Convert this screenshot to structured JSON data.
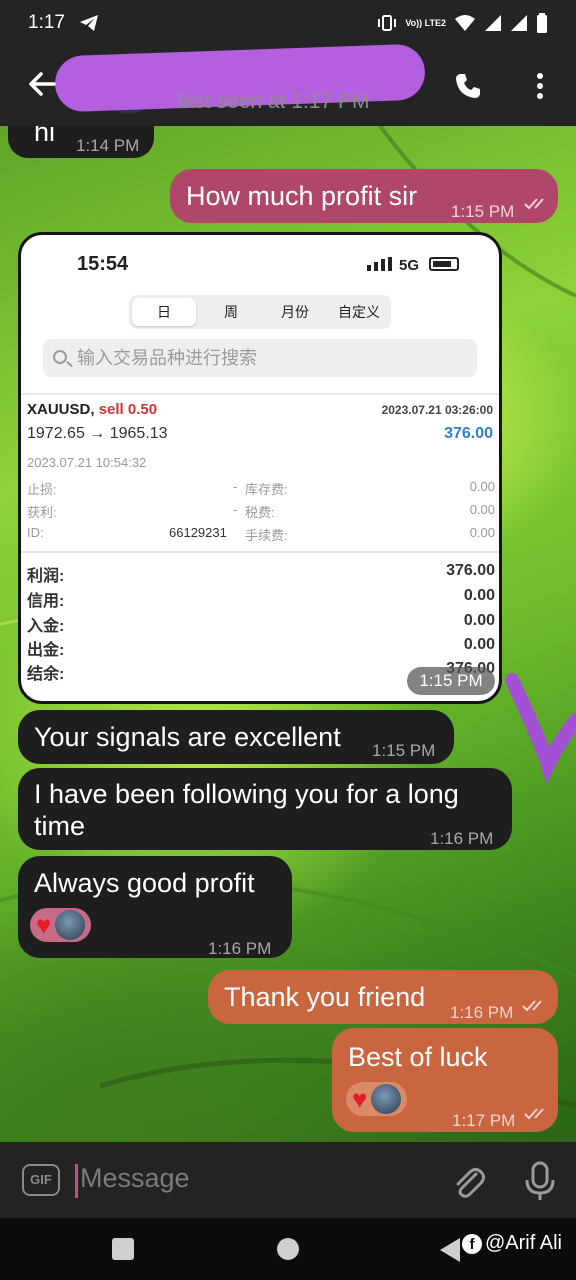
{
  "status_bar": {
    "time": "1:17",
    "network_label": "Vo)) LTE2"
  },
  "header": {
    "last_seen": "last seen at 1:17 PM"
  },
  "messages": [
    {
      "direction": "in",
      "text": "hi",
      "time": "1:14 PM"
    },
    {
      "direction": "out",
      "text": "How much profit sir",
      "time": "1:15 PM"
    },
    {
      "direction": "out",
      "type": "image",
      "time": "1:15 PM"
    },
    {
      "direction": "in",
      "text": "Your signals are excellent",
      "time": "1:15 PM"
    },
    {
      "direction": "in",
      "text_lines": [
        "I have been following you for a long",
        "time"
      ],
      "time": "1:16 PM"
    },
    {
      "direction": "in",
      "text": "Always good profit",
      "time": "1:16 PM",
      "reaction": "heart"
    },
    {
      "direction": "out",
      "text": "Thank you friend",
      "time": "1:16 PM"
    },
    {
      "direction": "out",
      "text": "Best of luck",
      "time": "1:17 PM",
      "reaction": "heart"
    }
  ],
  "trade_screenshot": {
    "status_time": "15:54",
    "network": "5G",
    "tabs": [
      "日",
      "周",
      "月份",
      "自定义"
    ],
    "search_placeholder": "输入交易品种进行搜索",
    "symbol": "XAUUSD,",
    "side": "sell 0.50",
    "close_time": "2023.07.21 03:26:00",
    "prices": "1972.65 → 1965.13",
    "profit": "376.00",
    "open_time": "2023.07.21 10:54:32",
    "details": [
      {
        "label": "止损:",
        "value": "-",
        "label2": "库存费:",
        "value2": "0.00"
      },
      {
        "label": "获利:",
        "value": "-",
        "label2": "税费:",
        "value2": "0.00"
      },
      {
        "label": "ID:",
        "value": "66129231",
        "label2": "手续费:",
        "value2": "0.00"
      }
    ],
    "summary": [
      {
        "label": "利润:",
        "value": "376.00"
      },
      {
        "label": "信用:",
        "value": "0.00"
      },
      {
        "label": "入金:",
        "value": "0.00"
      },
      {
        "label": "出金:",
        "value": "0.00"
      },
      {
        "label": "结余:",
        "value": "376.00"
      }
    ]
  },
  "input": {
    "placeholder": "Message",
    "gif_label": "GIF"
  },
  "watermark": {
    "text": "@Arif Ali",
    "fb_glyph": "f"
  },
  "colors": {
    "out_pink": "#b0476a",
    "out_orange": "#c9653f",
    "in_bubble": "#1e1e1e",
    "heart": "#e21c2b",
    "scribble": "#b45ee0"
  }
}
